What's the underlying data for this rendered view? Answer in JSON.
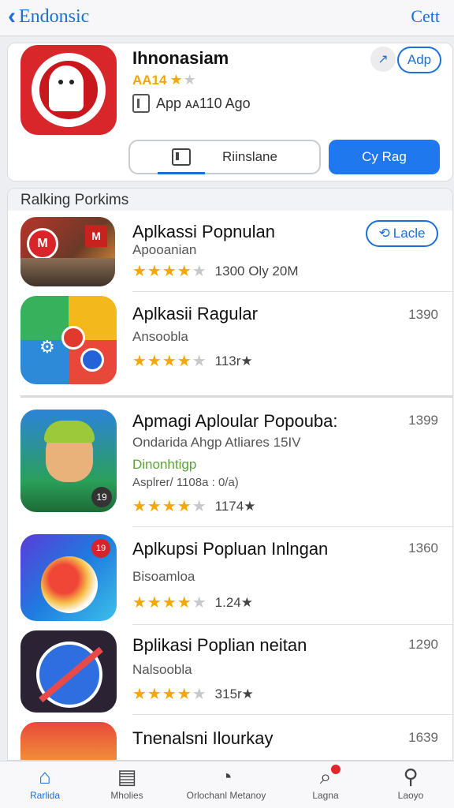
{
  "nav": {
    "back_label": "Endonsic",
    "edit_label": "Cett"
  },
  "featured": {
    "title": "Ihnonasiam",
    "rating_text": "AA14",
    "rating_stars": "★",
    "rating_star_off": "★",
    "meta_text": "App ᴀᴀ110 Ago",
    "share_icon": "↗",
    "add_label": "Adp",
    "segment_label": "Riinslane",
    "primary_label": "Cy Rag"
  },
  "section": {
    "title": "Ralking Porkims"
  },
  "rows": [
    {
      "name": "Aplkassi Popnulan",
      "sub": "Apooanian",
      "stars": "★★★★",
      "star_off": "★",
      "info": "1300 Oly  20M",
      "action_label": "Lacle"
    },
    {
      "name": "Aplkasii Ragular",
      "sub": "Ansoobla",
      "stars": "★★★★",
      "star_off": "★",
      "info": "113r★",
      "price": "1390"
    },
    {
      "name": "Apmagi Aploular     Popouba:",
      "sub": "Ondarida  Ahgp  Atliares  15IV",
      "sub2": "Dinonhtigp",
      "sub3": "Asplrer/ 1108a : 0/a)",
      "stars": "★★★★",
      "star_off": "★",
      "info": "1174★",
      "price": "1399"
    },
    {
      "name": "Aplkupsi Popluan Inlngan",
      "sub": "Bisoamloa",
      "stars": "★★★★",
      "star_off": "★",
      "info": "1.24★",
      "price": "1360"
    },
    {
      "name": "Bplikasi Poplian neitan",
      "sub": "Nalsoobla",
      "stars": "★★★★",
      "star_off": "★",
      "info": "315r★",
      "price": "1290"
    },
    {
      "name": "Tnenalsni Ilourkay",
      "price": "1639"
    }
  ],
  "tabs": [
    {
      "label": "Rarlida",
      "icon": "⌂"
    },
    {
      "label": "Mholies",
      "icon": "▤"
    },
    {
      "label": "Orlochanl Metanoy",
      "icon": "◔"
    },
    {
      "label": "Lagna",
      "icon": "⌕"
    },
    {
      "label": "Laoyo",
      "icon": "⚲"
    }
  ],
  "colors": {
    "accent": "#1a6fd8",
    "star": "#f5a800",
    "primary_button": "#1f78ee"
  }
}
